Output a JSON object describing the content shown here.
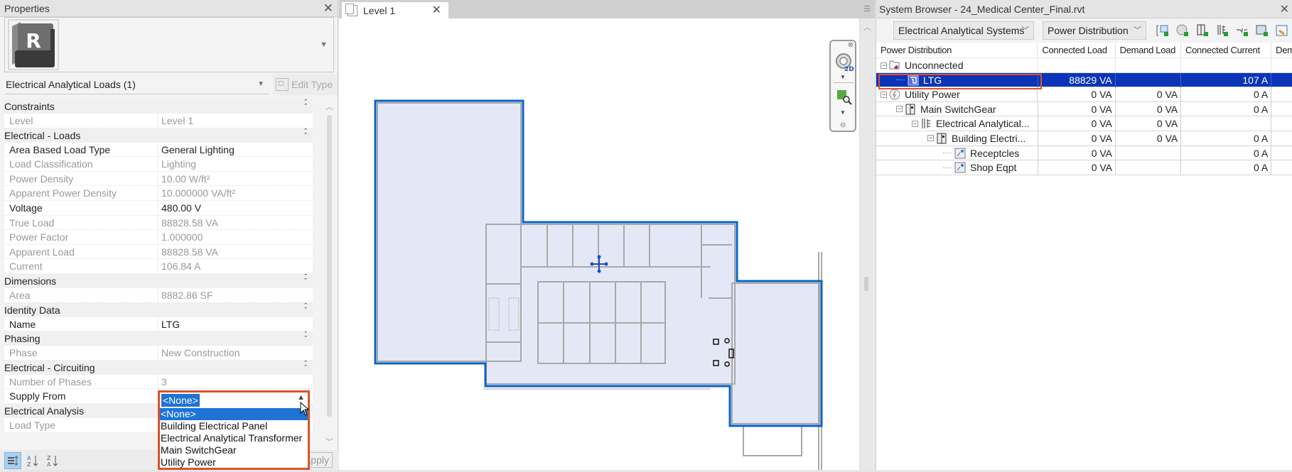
{
  "properties": {
    "title": "Properties",
    "instance_selector": "Electrical Analytical Loads (1)",
    "edit_type_label": "Edit Type",
    "apply_label": "Apply",
    "groups": [
      {
        "name": "Constraints",
        "rows": [
          {
            "key": "Level",
            "value": "Level 1",
            "editable": false
          }
        ]
      },
      {
        "name": "Electrical - Loads",
        "rows": [
          {
            "key": "Area Based Load Type",
            "value": "General Lighting",
            "editable": true
          },
          {
            "key": "Load Classification",
            "value": "Lighting",
            "editable": false
          },
          {
            "key": "Power Density",
            "value": "10.00 W/ft²",
            "editable": false
          },
          {
            "key": "Apparent Power Density",
            "value": "10.000000 VA/ft²",
            "editable": false
          },
          {
            "key": "Voltage",
            "value": "480.00 V",
            "editable": true
          },
          {
            "key": "True Load",
            "value": "88828.58 VA",
            "editable": false
          },
          {
            "key": "Power Factor",
            "value": "1.000000",
            "editable": false
          },
          {
            "key": "Apparent Load",
            "value": "88828.58 VA",
            "editable": false
          },
          {
            "key": "Current",
            "value": "106.84 A",
            "editable": false
          }
        ]
      },
      {
        "name": "Dimensions",
        "rows": [
          {
            "key": "Area",
            "value": "8882.86 SF",
            "editable": false
          }
        ]
      },
      {
        "name": "Identity Data",
        "rows": [
          {
            "key": "Name",
            "value": "LTG",
            "editable": true
          }
        ]
      },
      {
        "name": "Phasing",
        "rows": [
          {
            "key": "Phase",
            "value": "New Construction",
            "editable": false
          }
        ]
      },
      {
        "name": "Electrical - Circuiting",
        "rows": [
          {
            "key": "Number of Phases",
            "value": "3",
            "editable": false
          },
          {
            "key": "Supply From",
            "value": "<None>",
            "editable": true
          }
        ]
      },
      {
        "name": "Electrical Analysis",
        "rows": [
          {
            "key": "Load Type",
            "value": "",
            "editable": false
          }
        ]
      }
    ],
    "supply_from_dropdown": {
      "current": "<None>",
      "options": [
        "<None>",
        "Building Electrical Panel",
        "Electrical Analytical Transformer",
        "Main SwitchGear",
        "Utility Power"
      ],
      "selected_index": 0
    },
    "sort_buttons": [
      "categorize",
      "sort-ascending",
      "sort-descending"
    ]
  },
  "view": {
    "tab_label": "Level 1",
    "navigation_bar": [
      "2D steering wheel",
      "zoom region"
    ],
    "floor_plan": {
      "accent_color": "#0a64c8",
      "fill_color": "#e4e8f6"
    }
  },
  "system_browser": {
    "title": "System Browser - 24_Medical Center_Final.rvt",
    "systems_combo": "Electrical Analytical Systems",
    "view_combo": "Power Distribution",
    "toolbar_icons": [
      "add-panel-icon",
      "add-power-source-icon",
      "add-switchboard-icon",
      "add-transformer-icon",
      "add-connector-icon",
      "add-load-icon",
      "swap-icon"
    ],
    "columns": [
      "Power Distribution",
      "Connected Load",
      "Demand Load",
      "Connected Current",
      "Demand Current"
    ],
    "column_headers_visible": [
      "Power Distribution",
      "Connected Load",
      "Demand Load",
      "Connected Current",
      "Dem"
    ],
    "rows": [
      {
        "name": "Unconnected",
        "level": 0,
        "icon": "unconnected-icon",
        "expander": "−",
        "connected_load": "",
        "demand_load": "",
        "connected_current": ""
      },
      {
        "name": "LTG",
        "level": 1,
        "icon": "load-icon",
        "expander": "",
        "connected_load": "88829 VA",
        "demand_load": "",
        "connected_current": "107 A",
        "selected": true
      },
      {
        "name": "Utility Power",
        "level": 0,
        "icon": "power-source-icon",
        "expander": "−",
        "connected_load": "0 VA",
        "demand_load": "0 VA",
        "connected_current": "0 A"
      },
      {
        "name": "Main SwitchGear",
        "level": 1,
        "icon": "switchgear-icon",
        "expander": "−",
        "connected_load": "0 VA",
        "demand_load": "0 VA",
        "connected_current": "0 A"
      },
      {
        "name": "Electrical Analytical...",
        "level": 2,
        "icon": "transformer-icon",
        "expander": "−",
        "connected_load": "0 VA",
        "demand_load": "0 VA",
        "connected_current": ""
      },
      {
        "name": "Building Electri...",
        "level": 3,
        "icon": "panel-icon",
        "expander": "−",
        "connected_load": "0 VA",
        "demand_load": "0 VA",
        "connected_current": "0 A"
      },
      {
        "name": "Receptcles",
        "level": 4,
        "icon": "equipment-load-icon",
        "expander": "",
        "connected_load": "0 VA",
        "demand_load": "",
        "connected_current": "0 A"
      },
      {
        "name": "Shop Eqpt",
        "level": 4,
        "icon": "equipment-load-icon",
        "expander": "",
        "connected_load": "0 VA",
        "demand_load": "",
        "connected_current": "0 A"
      }
    ]
  },
  "colors": {
    "selection_blue": "#1e73d6",
    "tree_selection": "#0b35b8",
    "highlight_outline": "#d9532a"
  }
}
